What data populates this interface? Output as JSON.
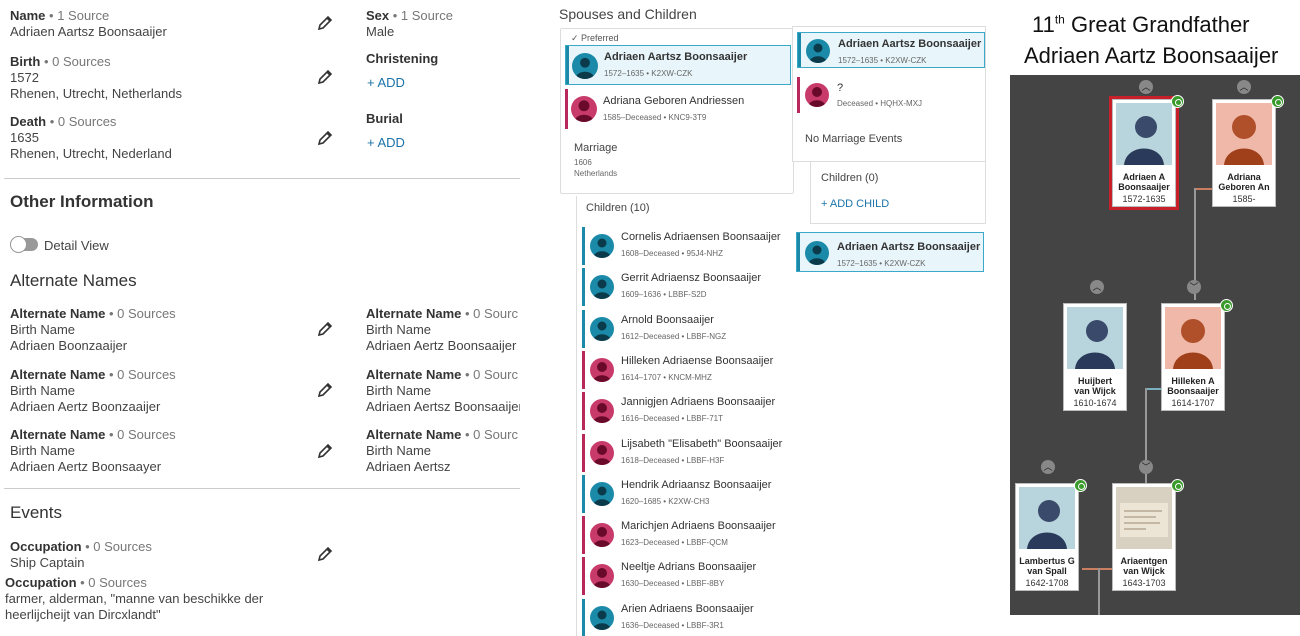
{
  "vitals": {
    "name": {
      "label": "Name",
      "sources": " • 1 Source",
      "value": "Adriaen Aartsz Boonsaaijer"
    },
    "sex": {
      "label": "Sex",
      "sources": " • 1 Source",
      "value": "Male"
    },
    "birth": {
      "label": "Birth",
      "sources": " • 0 Sources",
      "date": "1572",
      "place": "Rhenen, Utrecht, Netherlands"
    },
    "christening": {
      "label": "Christening",
      "add": "+  ADD"
    },
    "death": {
      "label": "Death",
      "sources": " • 0 Sources",
      "date": "1635",
      "place": "Rhenen, Utrecht, Nederland"
    },
    "burial": {
      "label": "Burial",
      "add": "+  ADD"
    }
  },
  "other_info": {
    "title": "Other Information",
    "detail_view": "Detail View",
    "alt_names_title": "Alternate Names",
    "alt_names": [
      {
        "label": "Alternate Name",
        "sources": " • 0 Sources",
        "type": "Birth Name",
        "value": "Adriaen Boonzaaijer"
      },
      {
        "label": "Alternate Name",
        "sources": " • 0 Sourc",
        "type": "Birth Name",
        "value": "Adriaen Aertz Boonsaaijer"
      },
      {
        "label": "Alternate Name",
        "sources": " • 0 Sources",
        "type": "Birth Name",
        "value": "Adriaen Aertz Boonzaaijer"
      },
      {
        "label": "Alternate Name",
        "sources": " • 0 Sourc",
        "type": "Birth Name",
        "value": "Adriaen Aertsz Boonsaaijer"
      },
      {
        "label": "Alternate Name",
        "sources": " • 0 Sources",
        "type": "Birth Name",
        "value": "Adriaen Aertz Boonsaayer"
      },
      {
        "label": "Alternate Name",
        "sources": " • 0 Sourc",
        "type": "Birth Name",
        "value": "Adriaen Aertsz"
      }
    ],
    "events_title": "Events",
    "events": [
      {
        "label": "Occupation",
        "sources": " • 0 Sources",
        "value": "Ship Captain"
      },
      {
        "label": "Occupation",
        "sources": " • 0 Sources",
        "value": "farmer, alderman, \"manne van beschikke der",
        "value2": "heerlijcheijt van Dircxlandt\""
      }
    ]
  },
  "family": {
    "title": "Spouses and Children",
    "preferred": "Preferred",
    "husband": {
      "name": "Adriaen Aartsz Boonsaaijer",
      "meta": "1572–1635 • K2XW-CZK"
    },
    "wife": {
      "name": "Adriana Geboren Andriessen",
      "meta": "1585–Deceased • KNC9-3T9"
    },
    "marriage": {
      "label": "Marriage",
      "date": "1606",
      "place": "Netherlands"
    },
    "children_header": "Children (10)",
    "children": [
      {
        "name": "Cornelis Adriaensen Boonsaaijer",
        "meta": "1608–Deceased • 95J4-NHZ",
        "sex": "M"
      },
      {
        "name": "Gerrit Adriaensz Boonsaaijer",
        "meta": "1609–1636 • LBBF-S2D",
        "sex": "M"
      },
      {
        "name": "Arnold Boonsaaijer",
        "meta": "1612–Deceased • LBBF-NGZ",
        "sex": "M"
      },
      {
        "name": "Hilleken Adriaense Boonsaaijer",
        "meta": "1614–1707 • KNCM-MHZ",
        "sex": "F"
      },
      {
        "name": "Jannigjen Adriaens Boonsaaijer",
        "meta": "1616–Deceased • LBBF-71T",
        "sex": "F"
      },
      {
        "name": "Lijsabeth \"Elisabeth\" Boonsaaijer",
        "meta": "1618–Deceased • LBBF-H3F",
        "sex": "F"
      },
      {
        "name": "Hendrik Adriaansz Boonsaaijer",
        "meta": "1620–1685 • K2XW-CH3",
        "sex": "M"
      },
      {
        "name": "Marichjen Adriaens Boonsaaijer",
        "meta": "1623–Deceased • LBBF-QCM",
        "sex": "F"
      },
      {
        "name": "Neeltje Adrians Boonsaaijer",
        "meta": "1630–Deceased • LBBF-8BY",
        "sex": "F"
      },
      {
        "name": "Arien Adriaens Boonsaaijer",
        "meta": "1636–Deceased • LBBF-3R1",
        "sex": "M"
      }
    ],
    "family2": {
      "husband": {
        "name": "Adriaen Aartsz Boonsaaijer",
        "meta": "1572–1635 • K2XW-CZK"
      },
      "wife": {
        "name": "?",
        "meta": "Deceased • HQHX-MXJ"
      },
      "no_marriage": "No Marriage Events",
      "children_header": "Children (0)",
      "add_child": "+  ADD CHILD"
    },
    "family3": {
      "husband": {
        "name": "Adriaen Aartsz Boonsaaijer",
        "meta": "1572–1635 • K2XW-CZK"
      }
    }
  },
  "tree": {
    "title_prefix": "11",
    "title_sup": "th",
    "title_suffix": " Great Grandfather",
    "subtitle": "Adriaen Aartz Boonsaaijer",
    "people": [
      {
        "name1": "Adriaen A",
        "name2": "Boonsaaijer",
        "dates": "1572-1635"
      },
      {
        "name1": "Adriana",
        "name2": "Geboren An",
        "dates": "1585-"
      },
      {
        "name1": "Huijbert",
        "name2": "van Wijck",
        "dates": "1610-1674"
      },
      {
        "name1": "Hilleken A",
        "name2": "Boonsaaijer",
        "dates": "1614-1707"
      },
      {
        "name1": "Lambertus G",
        "name2": "van Spall",
        "dates": "1642-1708"
      },
      {
        "name1": "Ariaentgen",
        "name2": "van Wijck",
        "dates": "1643-1703"
      }
    ]
  },
  "colors": {
    "male": "#1a8aa8",
    "female": "#b8285a",
    "link": "#1a73a8",
    "focus": "#c8202b",
    "badge": "#3a9a2c"
  }
}
